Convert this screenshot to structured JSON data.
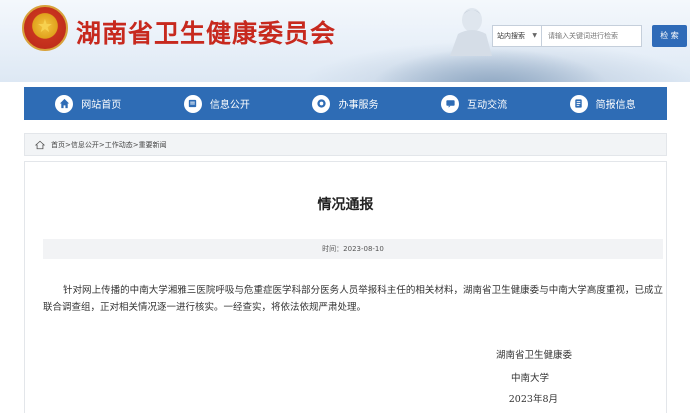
{
  "header": {
    "site_title": "湖南省卫生健康委员会",
    "emblem_glyph": "★"
  },
  "search": {
    "scope_label": "站内搜索",
    "placeholder": "请输入关键词进行检索",
    "button_label": "检 索"
  },
  "nav": {
    "items": [
      {
        "label": "网站首页",
        "icon": "home-icon"
      },
      {
        "label": "信息公开",
        "icon": "info-icon"
      },
      {
        "label": "办事服务",
        "icon": "service-icon"
      },
      {
        "label": "互动交流",
        "icon": "chat-icon"
      },
      {
        "label": "简报信息",
        "icon": "briefing-icon"
      }
    ]
  },
  "breadcrumb": {
    "text": "首页>信息公开>工作动态>重要新闻"
  },
  "article": {
    "title": "情况通报",
    "date_line": "时间：2023-08-10",
    "body": "针对网上传播的中南大学湘雅三医院呼吸与危重症医学科部分医务人员举报科主任的相关材料，湖南省卫生健康委与中南大学高度重视，已成立联合调查组，正对相关情况逐一进行核实。一经查实，将依法依规严肃处理。",
    "signatures": [
      "湖南省卫生健康委",
      "中南大学",
      "2023年8月"
    ]
  },
  "colors": {
    "brand_red": "#c7291e",
    "nav_blue": "#2e6cb5"
  }
}
